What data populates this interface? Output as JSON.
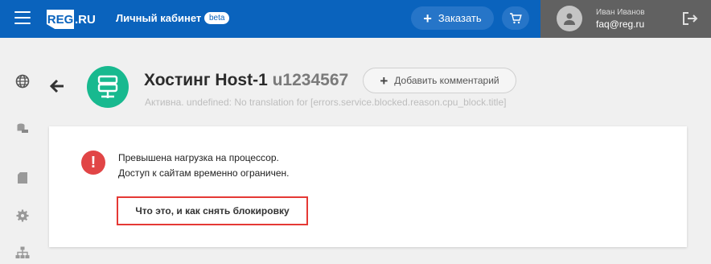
{
  "header": {
    "logo_mark": "REG",
    "logo_suffix": ".RU",
    "cabinet_label": "Личный кабинет",
    "beta_badge": "beta",
    "order_button": "Заказать",
    "user": {
      "name": "Иван Иванов",
      "email": "faq@reg.ru"
    },
    "colors": {
      "primary": "#0a63bd",
      "user_panel": "#616161"
    }
  },
  "sidebar": {
    "icons": [
      "globe-icon",
      "database-icon",
      "document-icon",
      "settings-icon",
      "sitemap-icon"
    ]
  },
  "service": {
    "title": "Хостинг Host-1",
    "login": "u1234567",
    "add_comment": "Добавить комментарий",
    "status": "Активна. undefined: No translation for [errors.service.blocked.reason.cpu_block.title]",
    "icon_color": "#18b98f"
  },
  "alert": {
    "line1": "Превышена нагрузка на процессор.",
    "line2": "Доступ к сайтам временно ограничен.",
    "help_link": "Что это, и как снять блокировку",
    "icon_color": "#e14546"
  }
}
